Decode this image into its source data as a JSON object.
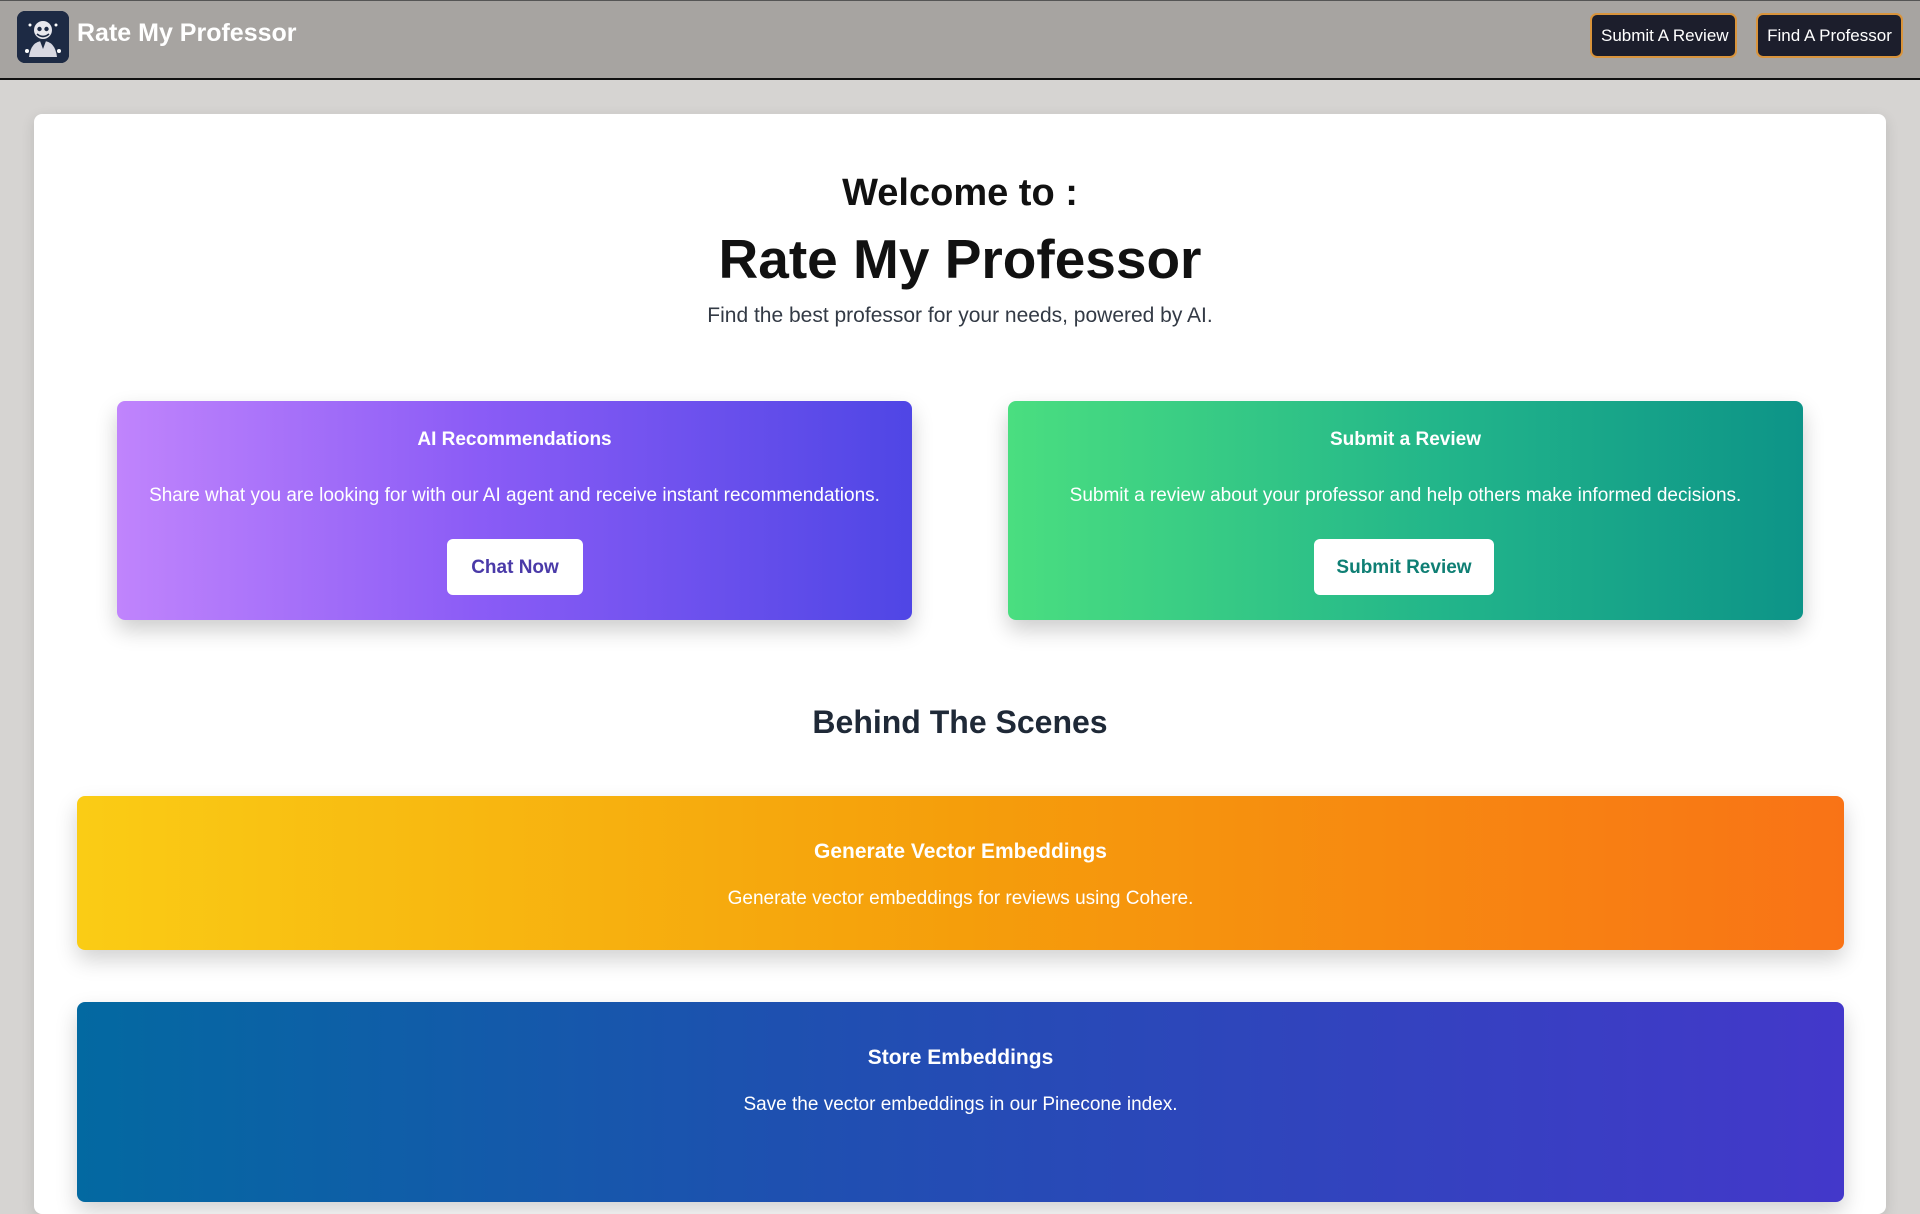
{
  "navbar": {
    "brand": "Rate My Professor",
    "logo_icon": "professor-avatar-icon",
    "submit_review_label": "Submit A Review",
    "find_professor_label": "Find A Professor"
  },
  "hero": {
    "welcome": "Welcome to :",
    "title": "Rate My Professor",
    "tagline": "Find the best professor for your needs, powered by AI."
  },
  "features": {
    "ai": {
      "title": "AI Recommendations",
      "description": "Share what you are looking for with our AI agent and receive instant recommendations.",
      "button": "Chat Now"
    },
    "submit": {
      "title": "Submit a Review",
      "description": "Submit a review about your professor and help others make informed decisions.",
      "button": "Submit Review"
    }
  },
  "behind": {
    "heading": "Behind The Scenes",
    "steps": [
      {
        "title": "Generate Vector Embeddings",
        "description": "Generate vector embeddings for reviews using Cohere."
      },
      {
        "title": "Store Embeddings",
        "description": "Save the vector embeddings in our Pinecone index."
      }
    ]
  },
  "colors": {
    "navbar_bg": "#a7a4a1",
    "nav_button_bg": "#1c1e2c",
    "nav_button_border": "#d9943c",
    "ai_gradient": [
      "#c084fc",
      "#4f46e5"
    ],
    "submit_gradient": [
      "#4ade80",
      "#0d9488"
    ],
    "embed_gradient": [
      "#facc15",
      "#f97316"
    ],
    "store_gradient": [
      "#0369a1",
      "#4338ca"
    ]
  }
}
